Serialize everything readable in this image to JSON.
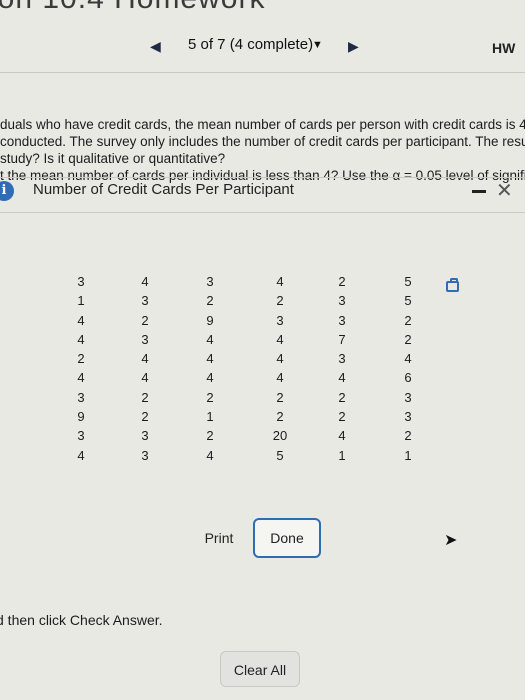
{
  "header": {
    "title": "ion 10.4 Homework",
    "progress": "5 of 7 (4 complete)",
    "hw_link": "HW"
  },
  "question": {
    "line1": "duals who have credit cards, the mean number of cards per person with credit cards is 4.",
    "line2": "conducted. The survey only includes the number of credit cards per participant. The resu",
    "line3": "study? Is it qualitative or quantitative?",
    "line4": "t the mean number of cards per individual is less than 4? Use the α = 0.05 level of signific"
  },
  "dialog": {
    "title": "Number of Credit Cards Per Participant",
    "columns": [
      [
        "3",
        "1",
        "4",
        "4",
        "2",
        "4",
        "3",
        "9",
        "3",
        "4"
      ],
      [
        "4",
        "3",
        "2",
        "3",
        "4",
        "4",
        "2",
        "2",
        "3",
        "3"
      ],
      [
        "3",
        "2",
        "9",
        "4",
        "4",
        "4",
        "2",
        "1",
        "2",
        "4"
      ],
      [
        "4",
        "2",
        "3",
        "4",
        "4",
        "4",
        "2",
        "2",
        "20",
        "5"
      ],
      [
        "2",
        "3",
        "3",
        "7",
        "3",
        "4",
        "2",
        "2",
        "4",
        "1"
      ],
      [
        "5",
        "5",
        "2",
        "2",
        "4",
        "6",
        "3",
        "3",
        "2",
        "1"
      ]
    ],
    "print_label": "Print",
    "done_label": "Done"
  },
  "footer": {
    "instruction": "d then click Check Answer.",
    "clear_label": "Clear All"
  },
  "colors": {
    "accent": "#2e6db4",
    "background": "#e9e9e4"
  },
  "icons": [
    "info-icon",
    "minimize-icon",
    "close-icon",
    "copy-icon",
    "prev-arrow-icon",
    "next-arrow-icon",
    "dropdown-caret-icon",
    "cursor-icon"
  ]
}
